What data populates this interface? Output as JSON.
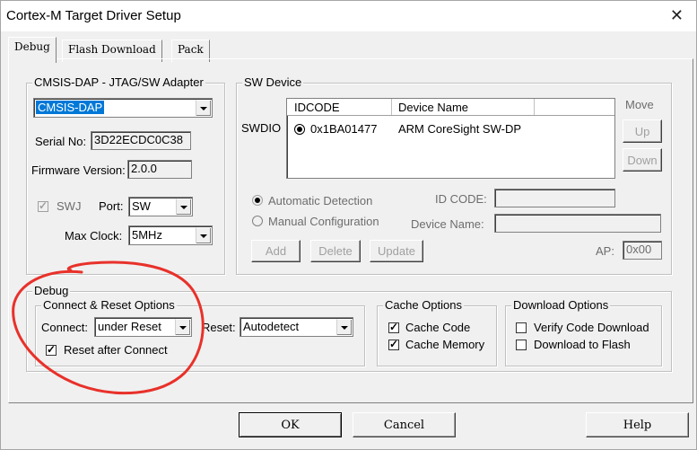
{
  "window": {
    "title": "Cortex-M Target Driver Setup"
  },
  "tabs": [
    {
      "label": "Debug"
    },
    {
      "label": "Flash Download"
    },
    {
      "label": "Pack"
    }
  ],
  "adapter": {
    "legend": "CMSIS-DAP - JTAG/SW Adapter",
    "selected": "CMSIS-DAP",
    "serial_label": "Serial No:",
    "serial_value": "3D22ECDC0C38",
    "fw_label": "Firmware Version:",
    "fw_value": "2.0.0",
    "swj_label": "SWJ",
    "port_label": "Port:",
    "port_value": "SW",
    "maxclock_label": "Max Clock:",
    "maxclock_value": "5MHz"
  },
  "sw_device": {
    "legend": "SW Device",
    "row_label": "SWDIO",
    "columns": [
      "IDCODE",
      "Device Name"
    ],
    "rows": [
      {
        "idcode": "0x1BA01477",
        "name": "ARM CoreSight SW-DP"
      }
    ],
    "move_label": "Move",
    "up_label": "Up",
    "down_label": "Down",
    "auto_detect": "Automatic Detection",
    "manual_config": "Manual Configuration",
    "idcode_label": "ID CODE:",
    "devname_label": "Device Name:",
    "add_label": "Add",
    "delete_label": "Delete",
    "update_label": "Update",
    "ap_label": "AP:",
    "ap_value": "0x00"
  },
  "debug": {
    "legend": "Debug",
    "connect_group": "Connect & Reset Options",
    "connect_label": "Connect:",
    "connect_value": "under Reset",
    "reset_label": "Reset:",
    "reset_value": "Autodetect",
    "reset_after_connect": "Reset after Connect"
  },
  "cache": {
    "legend": "Cache Options",
    "code": "Cache Code",
    "memory": "Cache Memory"
  },
  "download": {
    "legend": "Download Options",
    "verify": "Verify Code Download",
    "to_flash": "Download to Flash"
  },
  "buttons": {
    "ok": "OK",
    "cancel": "Cancel",
    "help": "Help"
  },
  "annotation_color": "#e8312a"
}
